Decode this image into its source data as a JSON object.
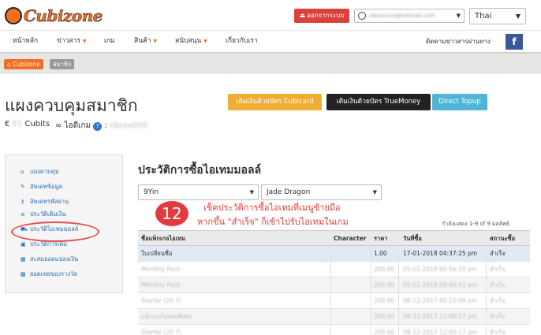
{
  "header": {
    "logo_text": "Cubizone",
    "logout_label": "ออกจากระบบ",
    "account_email": "cbzxxxxx@hotmail.com",
    "language": "Thai"
  },
  "nav": {
    "items": [
      {
        "label": "หน้าหลัก",
        "dropdown": false
      },
      {
        "label": "ข่าวสาร",
        "dropdown": true
      },
      {
        "label": "เกม",
        "dropdown": false
      },
      {
        "label": "สินค้า",
        "dropdown": true
      },
      {
        "label": "สนับสนุน",
        "dropdown": true
      },
      {
        "label": "เกี่ยวกับเรา",
        "dropdown": false
      }
    ],
    "follow_text": "ติดตามข่าวสารผ่านทาง",
    "fb_label": "f"
  },
  "breadcrumb": {
    "home": "Cubizone",
    "current": "สมาชิก"
  },
  "page": {
    "title": "แผงควบคุมสมาชิก",
    "cubits_prefix": "€",
    "cubits_value": "51",
    "cubits_unit": "Cubits",
    "gameid_label": "ไอดีเกม",
    "gameid_value": "cbzxx000",
    "topup_buttons": [
      "เติมเงินด้วยบัตร Cubicard",
      "เติมเงินด้วยบัตร TrueMoney",
      "Direct Topup"
    ]
  },
  "sidebar": {
    "items": [
      {
        "icon": "home-icon",
        "glyph": "⌂",
        "label": "แผงควบคุม"
      },
      {
        "icon": "edit-icon",
        "glyph": "✎",
        "label": "อัพเดทข้อมูล"
      },
      {
        "icon": "key-icon",
        "glyph": "⚷",
        "label": "อัพเดทรหัสผ่าน"
      },
      {
        "icon": "list-icon",
        "glyph": "≡",
        "label": "ประวัติเติมเงิน"
      },
      {
        "icon": "cart-icon",
        "glyph": "⛟",
        "label": "ประวัติไอเทมมอลล์"
      },
      {
        "icon": "gift-icon",
        "glyph": "▣",
        "label": "ประวัติการเติม"
      },
      {
        "icon": "calendar-icon",
        "glyph": "▦",
        "label": "สะสมยอดแปลงเงิน"
      },
      {
        "icon": "calendar-icon",
        "glyph": "▦",
        "label": "ยอดเขยของรางวัล"
      }
    ]
  },
  "main": {
    "title": "ประวัติการซื้อไอเทมมอลล์",
    "game_select": "9Yin",
    "server_select": "Jade Dragon",
    "step_number": "12",
    "note_line1": "เช็คประวัติการซื้อไอเทมที่เมนูซ้ายมือ",
    "note_line2": "หากขึ้น \"สำเร็จ\" ก็เข้าไปรับไอเทมในเกม",
    "count_text": "กำลังแสดง 1-9 of 9 ผลลัพธ์.",
    "table": {
      "headers": [
        "ชื่อแพ็กเกจไอเทม",
        "Character",
        "ราคา",
        "วันที่ซื้อ",
        "สถานะซื้อ"
      ],
      "rows": [
        [
          "ใบเปลี่ยนชื่อ",
          "",
          "1.00",
          "17-01-2018 04:37:25 pm",
          "สำเร็จ"
        ],
        [
          "Monthly Pack",
          "",
          "200.00",
          "05-01-2018 00:56:10 pm",
          "สำเร็จ"
        ],
        [
          "Monthly Pack",
          "",
          "200.00",
          "05-01-2018 00:40:41 pm",
          "สำเร็จ"
        ],
        [
          "Starter (20 7)",
          "",
          "200.00",
          "08-12-2017 00:25:09 pm",
          "สำเร็จ"
        ],
        [
          "แพ็กเกจไอเทมพิเศษ",
          "",
          "200.00",
          "08-12-2017 12:00:17 pm",
          "สำเร็จ"
        ],
        [
          "Starter (20 7)",
          "",
          "200.00",
          "08-12-2017 12:00:17 pm",
          "สำเร็จ"
        ]
      ]
    }
  },
  "colors": {
    "accent": "#f36f21",
    "logout": "#d9423a",
    "annotation": "#e33b3b",
    "link": "#2a6db5"
  }
}
